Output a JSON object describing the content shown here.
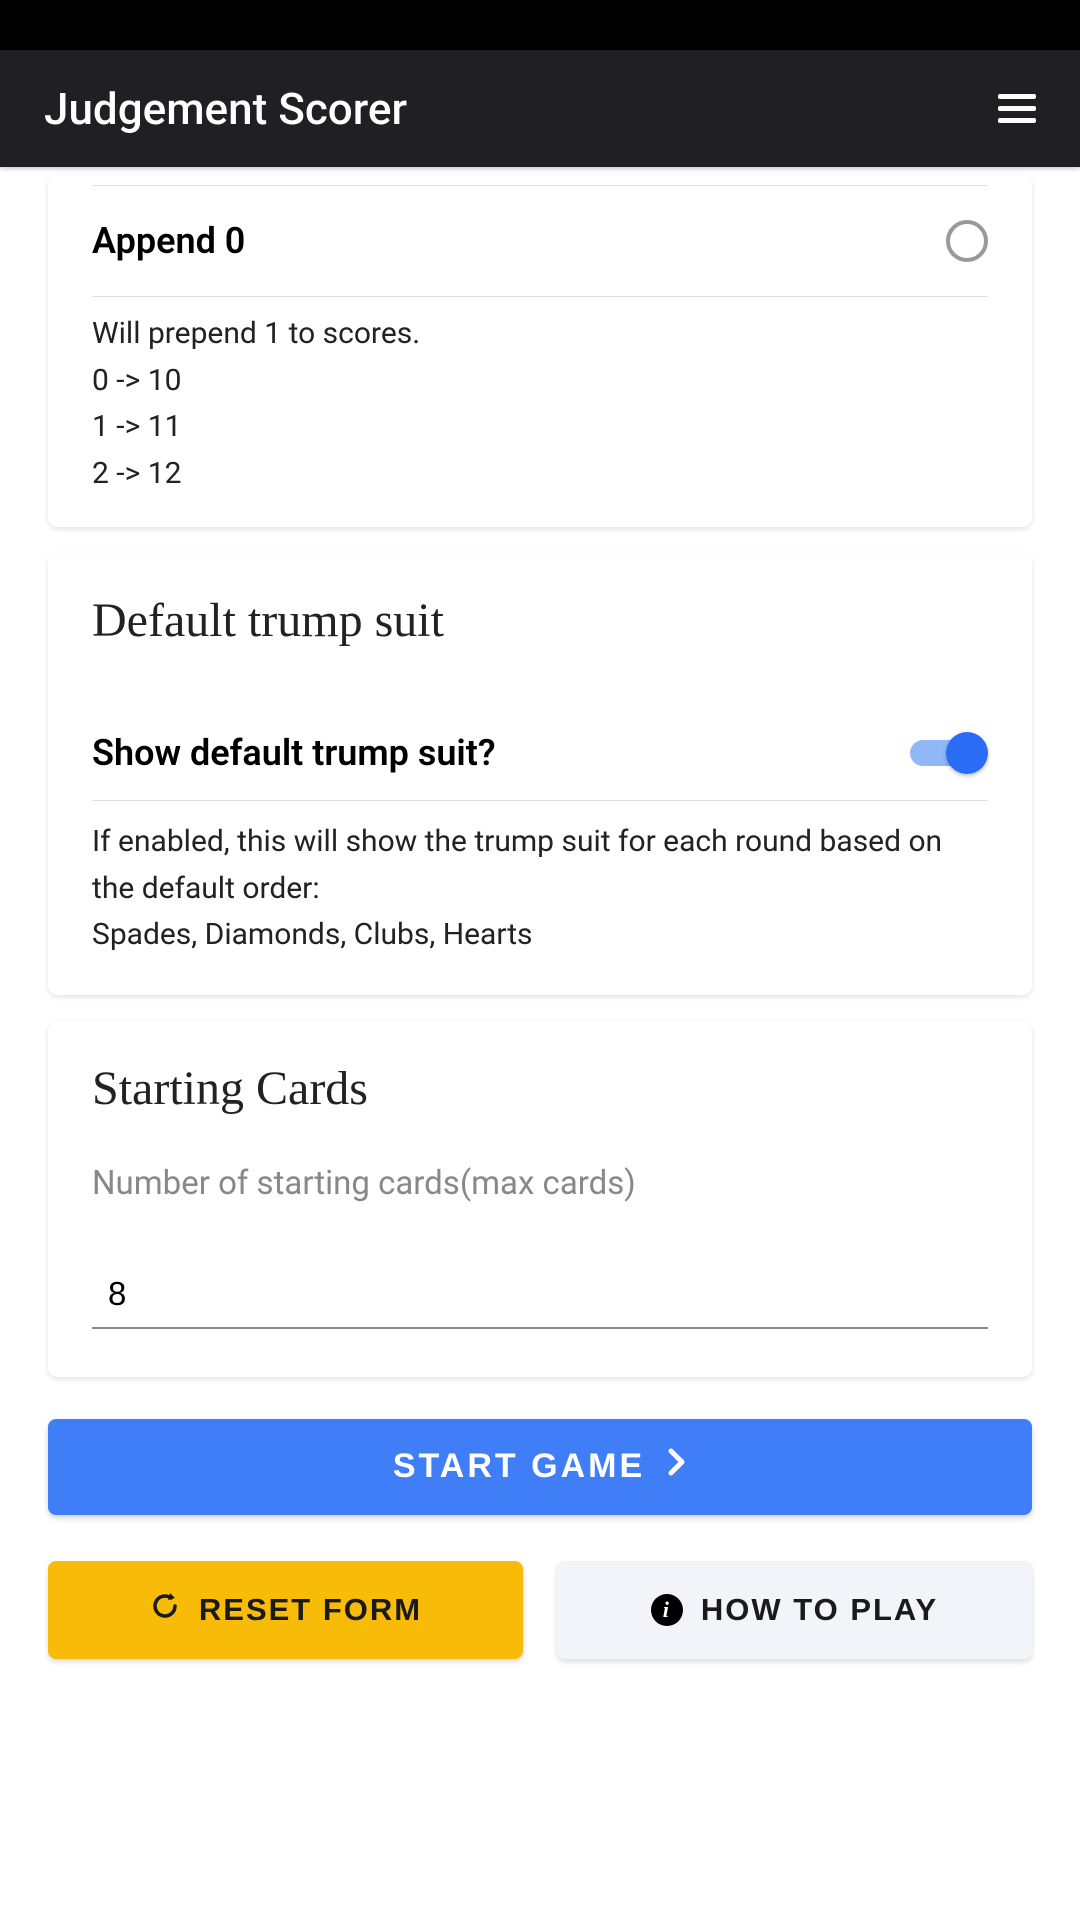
{
  "header": {
    "title": "Judgement Scorer"
  },
  "scoring": {
    "append_label": "Append 0",
    "append_checked": false,
    "helper_intro": "Will prepend 1 to scores.",
    "examples": [
      "0 -> 10",
      "1 -> 11",
      "2 -> 12"
    ]
  },
  "trump": {
    "section_title": "Default trump suit",
    "toggle_label": "Show default trump suit?",
    "toggle_on": true,
    "helper_line1": "If enabled, this will show the trump suit for each round based on the default order:",
    "helper_line2": "Spades, Diamonds, Clubs, Hearts"
  },
  "starting": {
    "section_title": "Starting Cards",
    "field_label": "Number of starting cards(max cards)",
    "value": "8"
  },
  "actions": {
    "start_label": "START GAME",
    "reset_label": "RESET FORM",
    "howto_label": "HOW TO PLAY"
  }
}
